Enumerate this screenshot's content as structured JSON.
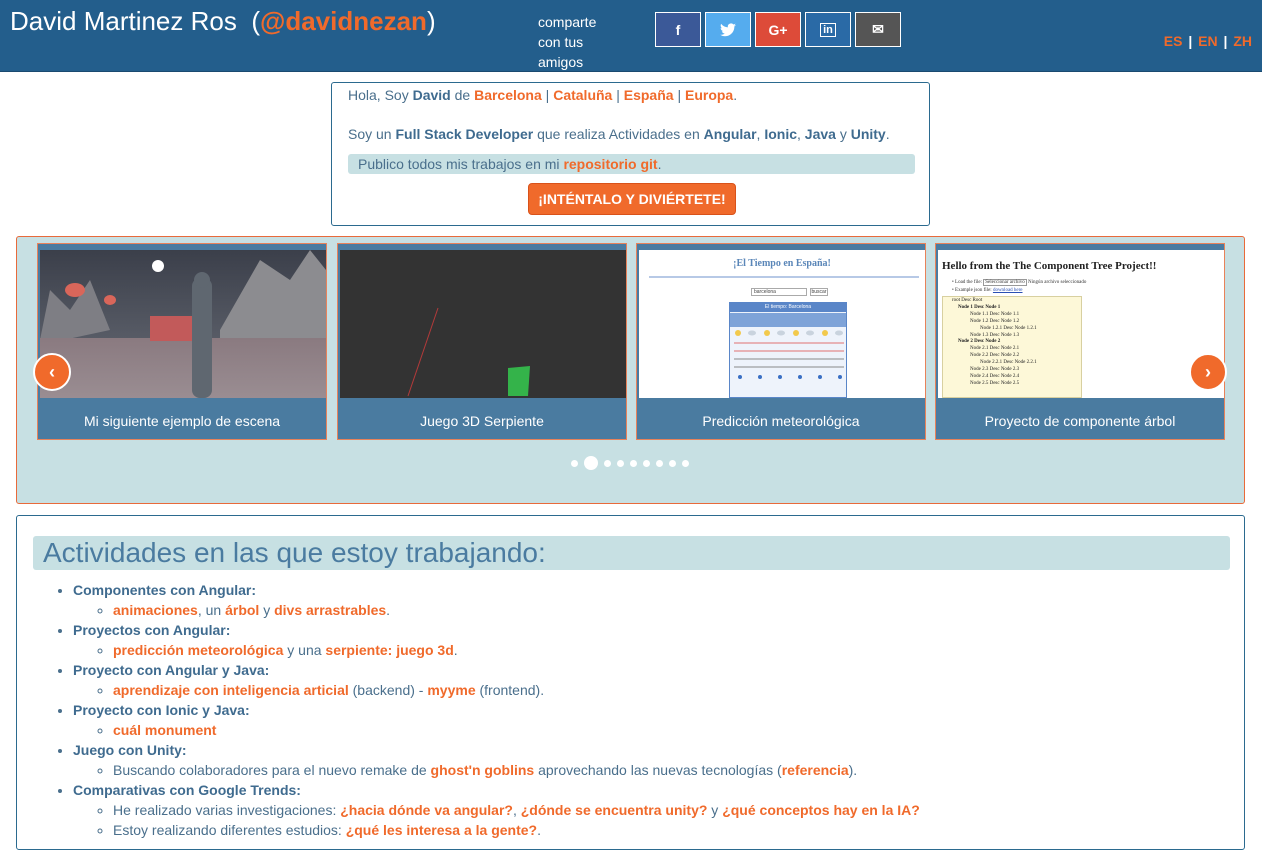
{
  "header": {
    "name": "David Martinez Ros",
    "paren_open": "(",
    "handle": "@davidnezan",
    "paren_close": ")",
    "share_text": "comparte con tus amigos",
    "social": [
      {
        "icon": "facebook-icon",
        "glyph": "f",
        "color": "#3b5998"
      },
      {
        "icon": "twitter-icon",
        "glyph": "t",
        "color": "#55acee"
      },
      {
        "icon": "google-plus-icon",
        "glyph": "G+",
        "color": "#dd4b39"
      },
      {
        "icon": "linkedin-icon",
        "glyph": "in",
        "color": "#2a6aa6"
      },
      {
        "icon": "mail-icon",
        "glyph": "✉",
        "color": "#555555"
      }
    ],
    "languages": [
      "ES",
      "EN",
      "ZH"
    ],
    "lang_sep": "|"
  },
  "intro": {
    "hola": "Hola, Soy ",
    "name": "David",
    "de": " de ",
    "places": [
      "Barcelona",
      "Cataluña",
      "España",
      "Europa"
    ],
    "sep": " | ",
    "dot": ".",
    "soy": "Soy un ",
    "role": "Full Stack Developer",
    "realiza": " que realiza Actividades en ",
    "tech1": "Angular",
    "comma1": ", ",
    "tech2": "Ionic",
    "comma2": ", ",
    "tech3": "Java",
    "y": " y ",
    "tech4": "Unity",
    "end": ".",
    "repo_text": "Publico todos mis trabajos en mi ",
    "repo_link": "repositorio git",
    "repo_end": ".",
    "cta": "¡INTÉNTALO Y DIVIÉRTETE!"
  },
  "carousel": {
    "cards": [
      {
        "caption": "Mi siguiente ejemplo de escena"
      },
      {
        "caption": "Juego 3D Serpiente"
      },
      {
        "caption": "Predicción meteorológica",
        "img_title": "¡El Tiempo en España!",
        "img_box": "El tiempo: Barcelona",
        "img_input": "barcelona",
        "img_btn": "buscar"
      },
      {
        "caption": "Proyecto de componente árbol",
        "img_title": "Hello from the The Component Tree Project!!",
        "img_line1": "Load the file:",
        "img_file_btn": "Seleccionar archivo",
        "img_file_note": "Ningún archivo seleccionado",
        "img_line2": "Example json file:",
        "img_link": "download here",
        "tree": [
          "root Desc Root",
          "Node 1 Desc Node 1",
          "Node 1.1 Desc Node 1.1",
          "Node 1.2 Desc Node 1.2",
          "Node 1.2.1 Desc Node 1.2.1",
          "Node 1.3 Desc Node 1.3",
          "Node 2 Desc Node 2",
          "Node 2.1 Desc Node 2.1",
          "Node 2.2 Desc Node 2.2",
          "Node 2.2.1 Desc Node 2.2.1",
          "Node 2.3 Desc Node 2.3",
          "Node 2.4 Desc Node 2.4",
          "Node 2.5 Desc Node 2.5"
        ]
      }
    ],
    "prev_glyph": "‹",
    "next_glyph": "›",
    "dot_count": 9,
    "active_dot": 1
  },
  "activities": {
    "title": "Actividades en las que estoy trabajando:",
    "items": [
      {
        "category": "Componentes con Angular:",
        "sub": [
          [
            [
              "link",
              "animaciones"
            ],
            [
              "text",
              ", un "
            ],
            [
              "link",
              "árbol"
            ],
            [
              "text",
              " y "
            ],
            [
              "link",
              "divs arrastrables"
            ],
            [
              "text",
              "."
            ]
          ]
        ]
      },
      {
        "category": "Proyectos con Angular:",
        "sub": [
          [
            [
              "link",
              "predicción meteorológica"
            ],
            [
              "text",
              " y una "
            ],
            [
              "link",
              "serpiente: juego 3d"
            ],
            [
              "text",
              "."
            ]
          ]
        ]
      },
      {
        "category": "Proyecto con Angular y Java:",
        "sub": [
          [
            [
              "link",
              "aprendizaje con inteligencia articial"
            ],
            [
              "text",
              " (backend) - "
            ],
            [
              "link",
              "myyme"
            ],
            [
              "text",
              " (frontend)."
            ]
          ]
        ]
      },
      {
        "category": "Proyecto con Ionic y Java:",
        "sub": [
          [
            [
              "link",
              "cuál monument"
            ]
          ]
        ]
      },
      {
        "category": "Juego con Unity:",
        "sub": [
          [
            [
              "text",
              "Buscando colaboradores para el nuevo remake de "
            ],
            [
              "link",
              "ghost'n goblins"
            ],
            [
              "text",
              " aprovechando las nuevas tecnologías ("
            ],
            [
              "link",
              "referencia"
            ],
            [
              "text",
              ")."
            ]
          ]
        ]
      },
      {
        "category": "Comparativas con Google Trends:",
        "sub": [
          [
            [
              "text",
              "He realizado varias investigaciones: "
            ],
            [
              "link",
              "¿hacia dónde va angular?"
            ],
            [
              "text",
              ", "
            ],
            [
              "link",
              "¿dónde se encuentra unity?"
            ],
            [
              "text",
              " y "
            ],
            [
              "link",
              "¿qué conceptos hay en la IA?"
            ]
          ],
          [
            [
              "text",
              "Estoy realizando diferentes estudios: "
            ],
            [
              "link",
              "¿qué les interesa a la gente?"
            ],
            [
              "text",
              "."
            ]
          ]
        ]
      }
    ]
  }
}
